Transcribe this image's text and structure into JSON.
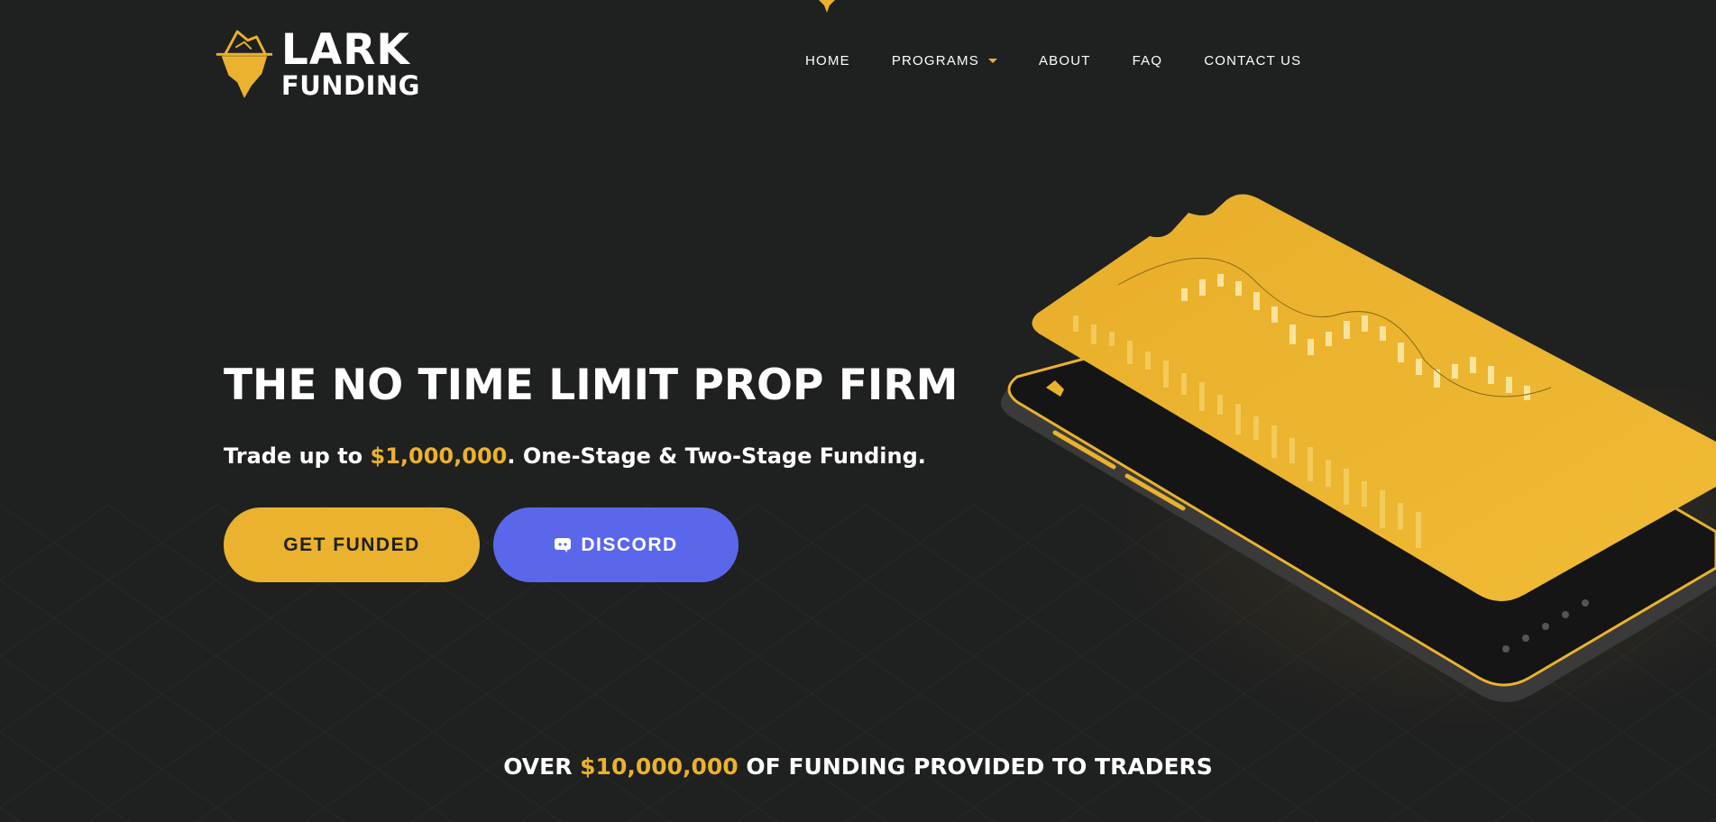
{
  "brand": {
    "line1": "LARK",
    "line2": "FUNDING"
  },
  "nav": {
    "items": [
      {
        "label": "HOME"
      },
      {
        "label": "PROGRAMS",
        "has_dropdown": true
      },
      {
        "label": "ABOUT"
      },
      {
        "label": "FAQ"
      },
      {
        "label": "CONTACT US"
      }
    ]
  },
  "hero": {
    "title": "THE NO TIME LIMIT PROP FIRM",
    "subtitle_prefix": "Trade up to ",
    "subtitle_amount": "$1,000,000",
    "subtitle_suffix": ". One-Stage & Two-Stage Funding.",
    "buttons": {
      "get_funded": "GET FUNDED",
      "discord": "DISCORD"
    }
  },
  "stats": {
    "prefix": "OVER ",
    "amount": "$10,000,000",
    "suffix": " OF FUNDING PROVIDED TO TRADERS"
  },
  "icons": {
    "logo": "iceberg-logo-icon",
    "discord": "discord-icon",
    "dropdown": "caret-down-icon",
    "phone": "trading-phone-illustration"
  },
  "colors": {
    "background": "#1f2020",
    "accent": "#eab22e",
    "discord": "#5b67ea",
    "text": "#ffffff"
  }
}
